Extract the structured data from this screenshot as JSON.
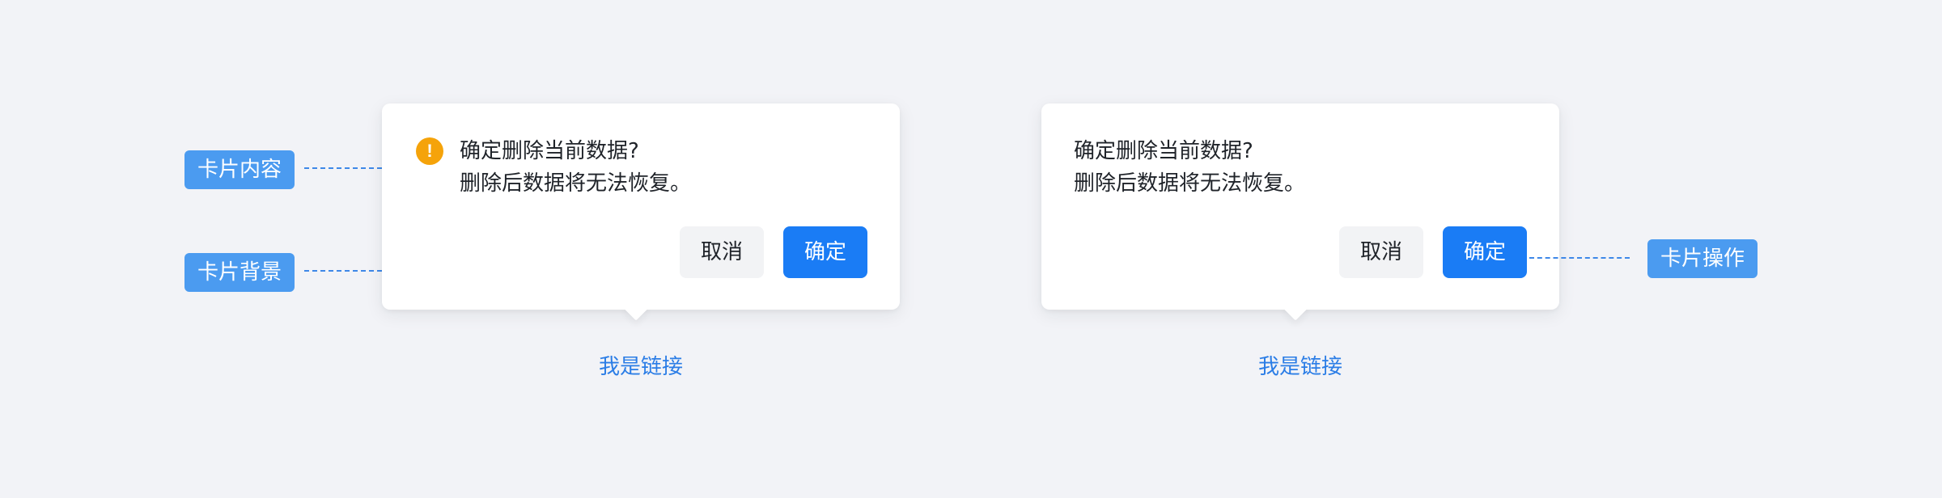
{
  "colors": {
    "background": "#f2f3f7",
    "primary": "#1a7cf5",
    "warning": "#f5a30a",
    "annotation_tag": "#4b9bf0",
    "link": "#2b7de6"
  },
  "annotations": {
    "card_content": "卡片内容",
    "card_background": "卡片背景",
    "card_actions": "卡片操作"
  },
  "popconfirm_with_icon": {
    "icon": "exclamation-warning-icon",
    "icon_glyph": "!",
    "title": "确定删除当前数据?",
    "description": "删除后数据将无法恢复。",
    "cancel_label": "取消",
    "ok_label": "确定",
    "trigger_link": "我是链接"
  },
  "popconfirm_plain": {
    "title": "确定删除当前数据?",
    "description": "删除后数据将无法恢复。",
    "cancel_label": "取消",
    "ok_label": "确定",
    "trigger_link": "我是链接"
  }
}
